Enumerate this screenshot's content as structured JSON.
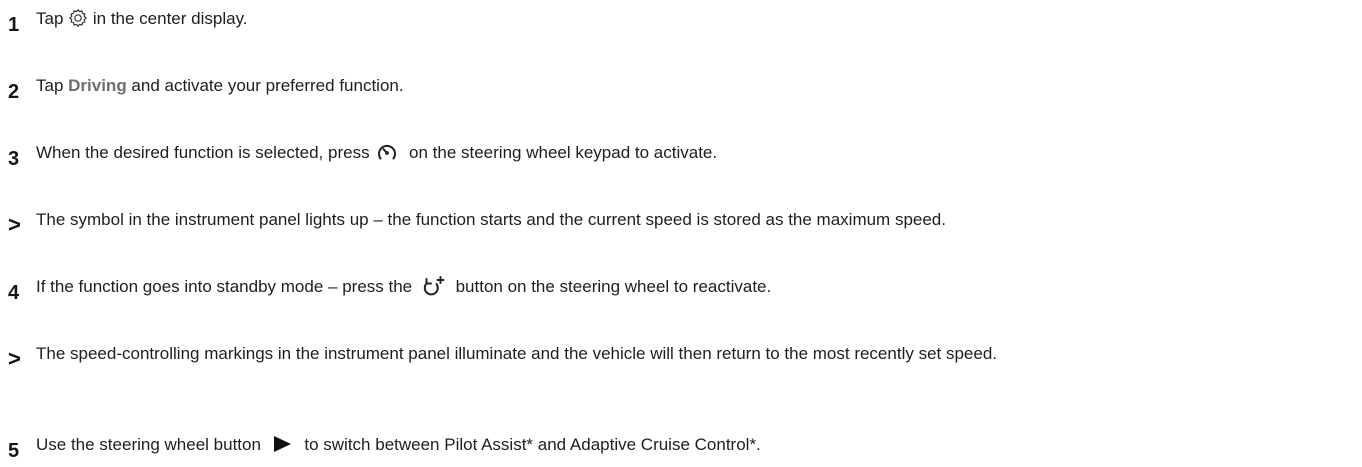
{
  "steps": [
    {
      "marker": "1",
      "kind": "number",
      "parts": [
        "Tap ",
        "settings-gear-icon",
        " in the center display."
      ]
    },
    {
      "marker": "2",
      "kind": "number",
      "text_before": "Tap ",
      "emph": "Driving",
      "text_after": " and activate your preferred function."
    },
    {
      "marker": "3",
      "kind": "number",
      "text_before": "When the desired function is selected, press ",
      "icon": "cruise-speedometer-icon",
      "text_after": " on the steering wheel keypad to activate."
    },
    {
      "marker": ">",
      "kind": "result",
      "text": "The symbol in the instrument panel lights up – the function starts and the current speed is stored as the maximum speed."
    },
    {
      "marker": "4",
      "kind": "number",
      "text_before": "If the function goes into standby mode – press the ",
      "icon": "resume-arrow-icon",
      "text_after": " button on the steering wheel to reactivate."
    },
    {
      "marker": ">",
      "kind": "result",
      "text": "The speed-controlling markings in the instrument panel illuminate and the vehicle will then return to the most recently set speed."
    },
    {
      "marker": "5",
      "kind": "number",
      "text_before": "Use the steering wheel button ",
      "icon": "play-triangle-icon",
      "text_after": " to switch between Pilot Assist* and Adaptive Cruise Control*."
    }
  ],
  "step1": {
    "text_before": "Tap ",
    "icon": "settings-gear-icon",
    "text_after": " in the center display."
  }
}
